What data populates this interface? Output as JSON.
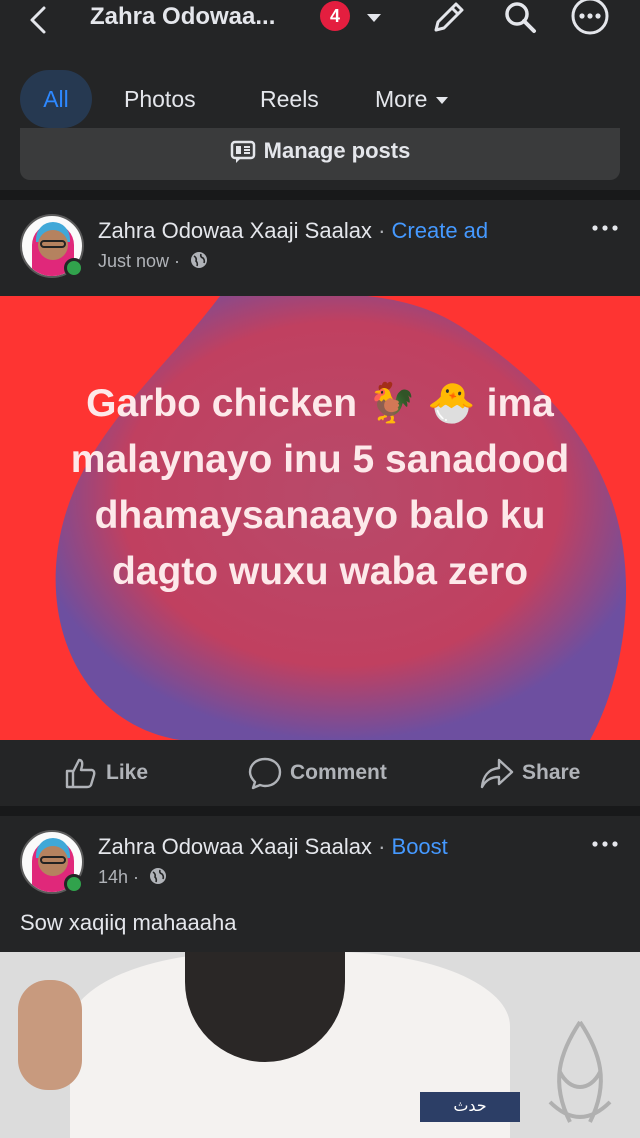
{
  "header": {
    "title": "Zahra Odowaa...",
    "notification_count": "4"
  },
  "tabs": [
    {
      "label": "All",
      "active": true
    },
    {
      "label": "Photos"
    },
    {
      "label": "Reels"
    },
    {
      "label": "More"
    }
  ],
  "manage_posts": {
    "label": "Manage posts"
  },
  "posts": [
    {
      "author": "Zahra Odowaa Xaaji Saalax",
      "separator": "·",
      "cta": "Create ad",
      "time": "Just now ·",
      "text_graphic": "Garbo chicken 🐓 🐣 ima malaynayo inu 5 sanadood dhamaysanaayo balo ku dagto wuxu waba zero",
      "background_color": "#fe3432"
    },
    {
      "author": "Zahra Odowaa Xaaji Saalax",
      "separator": "·",
      "cta": "Boost",
      "time": "14h ·",
      "caption": "Sow xaqiiq mahaaaha",
      "video_banner_text": "حدث"
    }
  ],
  "actions": {
    "like": "Like",
    "comment": "Comment",
    "share": "Share"
  },
  "colors": {
    "accent": "#2d88ff",
    "link": "#4599ff",
    "background": "#242526",
    "badge": "#e41e3f",
    "online": "#31a24c"
  }
}
